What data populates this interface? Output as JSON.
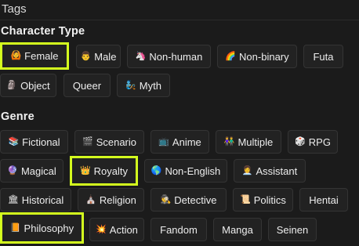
{
  "header": {
    "title": "Tags"
  },
  "sections": {
    "character_type": {
      "title": "Character Type"
    },
    "genre": {
      "title": "Genre"
    }
  },
  "accent": "#d4ff1e",
  "tags": {
    "female": {
      "label": "Female",
      "icon": "🙆",
      "icon_name": "woman-gesturing-icon",
      "selected": true
    },
    "male": {
      "label": "Male",
      "icon": "👨",
      "icon_name": "man-icon"
    },
    "non_human": {
      "label": "Non-human",
      "icon": "🦄",
      "icon_name": "unicorn-icon"
    },
    "non_binary": {
      "label": "Non-binary",
      "icon": "🌈",
      "icon_name": "rainbow-icon"
    },
    "futa": {
      "label": "Futa"
    },
    "object": {
      "label": "Object",
      "icon": "🗿",
      "icon_name": "moai-icon"
    },
    "queer": {
      "label": "Queer"
    },
    "myth": {
      "label": "Myth",
      "icon": "🧞",
      "icon_name": "genie-icon"
    },
    "fictional": {
      "label": "Fictional",
      "icon": "📚",
      "icon_name": "books-icon"
    },
    "scenario": {
      "label": "Scenario",
      "icon": "🎬",
      "icon_name": "clapper-icon"
    },
    "anime": {
      "label": "Anime",
      "icon": "📺",
      "icon_name": "tv-icon"
    },
    "multiple": {
      "label": "Multiple",
      "icon": "👫",
      "icon_name": "people-icon"
    },
    "rpg": {
      "label": "RPG",
      "icon": "🎲",
      "icon_name": "dice-icon"
    },
    "magical": {
      "label": "Magical",
      "icon": "🔮",
      "icon_name": "crystal-ball-icon"
    },
    "royalty": {
      "label": "Royalty",
      "icon": "👑",
      "icon_name": "crown-icon",
      "selected": true
    },
    "non_english": {
      "label": "Non-English",
      "icon": "🌎",
      "icon_name": "globe-icon"
    },
    "assistant": {
      "label": "Assistant",
      "icon": "👩‍💼",
      "icon_name": "office-worker-icon"
    },
    "historical": {
      "label": "Historical",
      "icon": "🏛",
      "icon_name": "classical-building-icon"
    },
    "religion": {
      "label": "Religion",
      "icon": "⛪",
      "icon_name": "church-icon"
    },
    "detective": {
      "label": "Detective",
      "icon": "🕵",
      "icon_name": "detective-icon"
    },
    "politics": {
      "label": "Politics",
      "icon": "📜",
      "icon_name": "scroll-icon"
    },
    "hentai": {
      "label": "Hentai"
    },
    "philosophy": {
      "label": "Philosophy",
      "icon": "📙",
      "icon_name": "book-icon",
      "selected": true
    },
    "action": {
      "label": "Action",
      "icon": "💥",
      "icon_name": "collision-icon"
    },
    "fandom": {
      "label": "Fandom"
    },
    "manga": {
      "label": "Manga"
    },
    "seinen": {
      "label": "Seinen"
    }
  }
}
